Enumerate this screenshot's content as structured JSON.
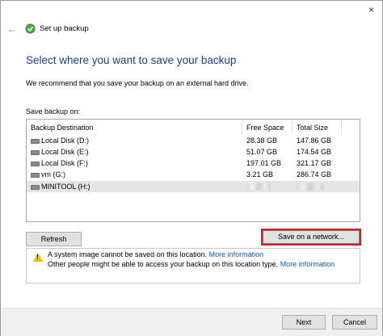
{
  "window": {
    "title": "Set up backup",
    "close_glyph": "×"
  },
  "heading": "Select where you want to save your backup",
  "recommendation": "We recommend that you save your backup on an external hard drive.",
  "save_label": "Save backup on:",
  "table": {
    "columns": [
      "Backup Destination",
      "Free Space",
      "Total Size"
    ],
    "rows": [
      {
        "name": "Local Disk (D:)",
        "free": "28.38 GB",
        "total": "147.86 GB"
      },
      {
        "name": "Local Disk (E:)",
        "free": "51.07 GB",
        "total": "174.54 GB"
      },
      {
        "name": "Local Disk (F:)",
        "free": "197.01 GB",
        "total": "321.17 GB"
      },
      {
        "name": "vm (G:)",
        "free": "3.21 GB",
        "total": "286.74 GB"
      },
      {
        "name": "MINITOOL (H:)",
        "free": "",
        "total": ""
      }
    ],
    "selected_index": 4
  },
  "buttons": {
    "refresh": "Refresh",
    "save_network": "Save on a network...",
    "next": "Next",
    "cancel": "Cancel"
  },
  "warnings": {
    "line1_text": "A system image cannot be saved on this location.",
    "line1_link": "More information",
    "line2_text": "Other people might be able to access your backup on this location type.",
    "line2_link": "More information"
  },
  "colors": {
    "heading": "#1a3d8f",
    "link": "#0b5cc6",
    "highlight_border": "#d42020"
  },
  "icons": {
    "back": "back-arrow-icon",
    "app": "backup-icon",
    "drive": "drive-icon",
    "warning": "warning-icon"
  }
}
